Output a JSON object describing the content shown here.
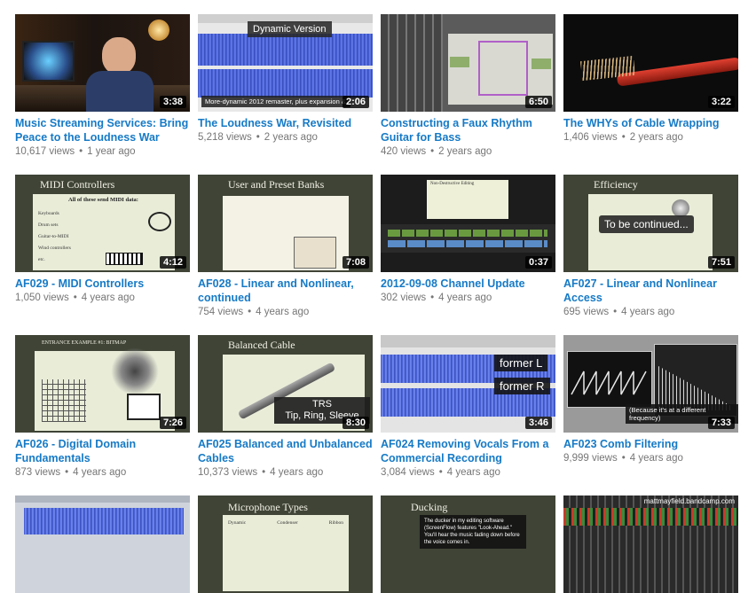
{
  "videos": [
    {
      "title": "Music Streaming Services: Bring Peace to the Loudness War",
      "views": "10,617 views",
      "age": "1 year ago",
      "duration": "3:38"
    },
    {
      "title": "The Loudness War, Revisited",
      "views": "5,218 views",
      "age": "2 years ago",
      "duration": "2:06",
      "overlay_top": "Dynamic Version",
      "overlay_bottom": "More-dynamic 2012 remaster, plus expansion & man"
    },
    {
      "title": "Constructing a Faux Rhythm Guitar for Bass",
      "views": "420 views",
      "age": "2 years ago",
      "duration": "6:50"
    },
    {
      "title": "The WHYs of Cable Wrapping",
      "views": "1,406 views",
      "age": "2 years ago",
      "duration": "3:22"
    },
    {
      "title": "AF029 - MIDI Controllers",
      "views": "1,050 views",
      "age": "4 years ago",
      "duration": "4:12",
      "slide_title": "MIDI Controllers",
      "slide_sub": "All of these send MIDI data:",
      "slide_items": [
        "Keyboards",
        "Drum sets",
        "Guitar-to-MIDI",
        "Wind controllers",
        "etc."
      ]
    },
    {
      "title": "AF028 - Linear and Nonlinear, continued",
      "views": "754 views",
      "age": "4 years ago",
      "duration": "7:08",
      "slide_title": "User and Preset Banks"
    },
    {
      "title": "2012-09-08 Channel Update",
      "views": "302 views",
      "age": "4 years ago",
      "duration": "0:37",
      "slide_title": "Non-Destructive Editing"
    },
    {
      "title": "AF027 - Linear and Nonlinear Access",
      "views": "695 views",
      "age": "4 years ago",
      "duration": "7:51",
      "slide_title": "Efficiency",
      "overlay_mid": "To be continued..."
    },
    {
      "title": "AF026 - Digital Domain Fundamentals",
      "views": "873 views",
      "age": "4 years ago",
      "duration": "7:26",
      "slide_title": "ENTRANCE EXAMPLE #1: BITMAP"
    },
    {
      "title": "AF025 Balanced and Unbalanced Cables",
      "views": "10,373 views",
      "age": "4 years ago",
      "duration": "8:30",
      "slide_title": "Balanced Cable",
      "overlay_box_1": "TRS",
      "overlay_box_2": "Tip, Ring, Sleeve"
    },
    {
      "title": "AF024 Removing Vocals From a Commercial Recording",
      "views": "3,084 views",
      "age": "4 years ago",
      "duration": "3:46",
      "overlay_box_1": "former L",
      "overlay_box_2": "former R"
    },
    {
      "title": "AF023 Comb Filtering",
      "views": "9,999 views",
      "age": "4 years ago",
      "duration": "7:33",
      "overlay_bottom": "(Because it's at a different frequency)"
    },
    {
      "title": "",
      "views": "",
      "age": "",
      "duration": ""
    },
    {
      "title": "",
      "views": "",
      "age": "",
      "duration": "",
      "slide_title": "Microphone Types",
      "slide_cols": [
        "Dynamic",
        "Condenser",
        "Ribbon"
      ]
    },
    {
      "title": "",
      "views": "",
      "age": "",
      "duration": "",
      "slide_title": "Ducking",
      "slide_sub": "The ducker in my editing software (ScreenFlow) features \"Look-Ahead.\" You'll hear the music fading down before the voice comes in."
    },
    {
      "title": "",
      "views": "",
      "age": "",
      "duration": "",
      "overlay_top": "mattmayfield.bandcamp.com"
    }
  ]
}
